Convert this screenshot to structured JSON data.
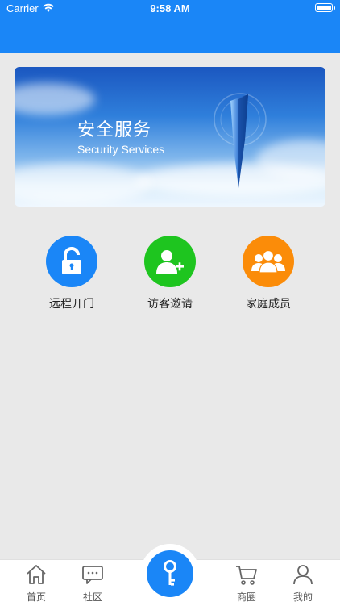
{
  "status_bar": {
    "carrier": "Carrier",
    "time": "9:58 AM"
  },
  "banner": {
    "title": "安全服务",
    "subtitle": "Security Services"
  },
  "features": [
    {
      "label": "远程开门",
      "icon": "unlock-icon",
      "color": "#1a86f7"
    },
    {
      "label": "访客邀请",
      "icon": "add-user-icon",
      "color": "#1ec51f"
    },
    {
      "label": "家庭成员",
      "icon": "group-icon",
      "color": "#fb8c09"
    }
  ],
  "tabbar": {
    "items": [
      {
        "label": "首页",
        "icon": "home-icon"
      },
      {
        "label": "社区",
        "icon": "chat-icon"
      },
      {
        "label": "商圈",
        "icon": "cart-icon"
      },
      {
        "label": "我的",
        "icon": "profile-icon"
      }
    ],
    "center_icon": "key-icon"
  },
  "colors": {
    "primary": "#1a86f7",
    "green": "#1ec51f",
    "orange": "#fb8c09",
    "background": "#e9e9e9"
  }
}
